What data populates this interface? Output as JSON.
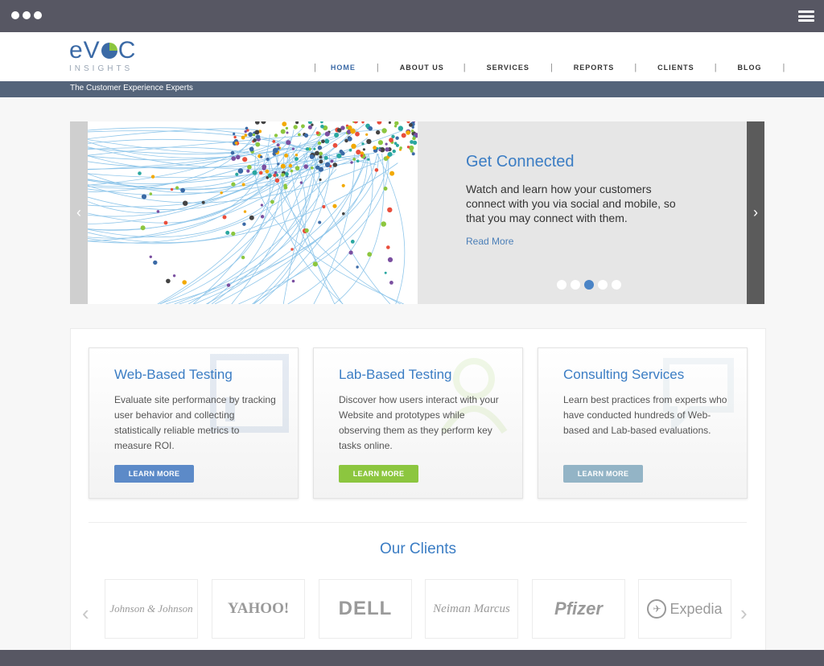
{
  "colors": {
    "brand": "#3b6aa6",
    "accent_blue": "#5c8ac8",
    "accent_green": "#8cc63f",
    "accent_grey": "#93b4c6",
    "tagline_bar": "#54647a"
  },
  "logo": {
    "main_left": "eV",
    "main_right": "C",
    "sub": "INSIGHTS"
  },
  "nav": {
    "items": [
      "HOME",
      "ABOUT US",
      "SERVICES",
      "REPORTS",
      "CLIENTS",
      "BLOG"
    ],
    "active": "HOME"
  },
  "tagline": "The Customer Experience Experts",
  "slider": {
    "title": "Get Connected",
    "text": "Watch and learn how your customers connect with you via social and mobile, so that you may connect with them.",
    "link": "Read More",
    "dot_count": 5,
    "active_dot": 3
  },
  "cards": [
    {
      "title": "Web-Based Testing",
      "text": "Evaluate site performance by tracking user behavior and collecting statistically reliable metrics to measure ROI.",
      "button": "LEARN MORE",
      "icon": "dashboard-icon"
    },
    {
      "title": "Lab-Based Testing",
      "text": "Discover how users interact with your Website and prototypes while observing them as they perform key tasks online.",
      "button": "LEARN MORE",
      "icon": "user-icon"
    },
    {
      "title": "Consulting Services",
      "text": "Learn best practices from experts who have conducted hundreds of Web-based and Lab-based evaluations.",
      "button": "LEARN MORE",
      "icon": "chat-icon"
    }
  ],
  "clients": {
    "title": "Our Clients",
    "logos": [
      "Johnson & Johnson",
      "YAHOO!",
      "DELL",
      "Neiman Marcus",
      "Pfizer",
      "Expedia"
    ]
  }
}
